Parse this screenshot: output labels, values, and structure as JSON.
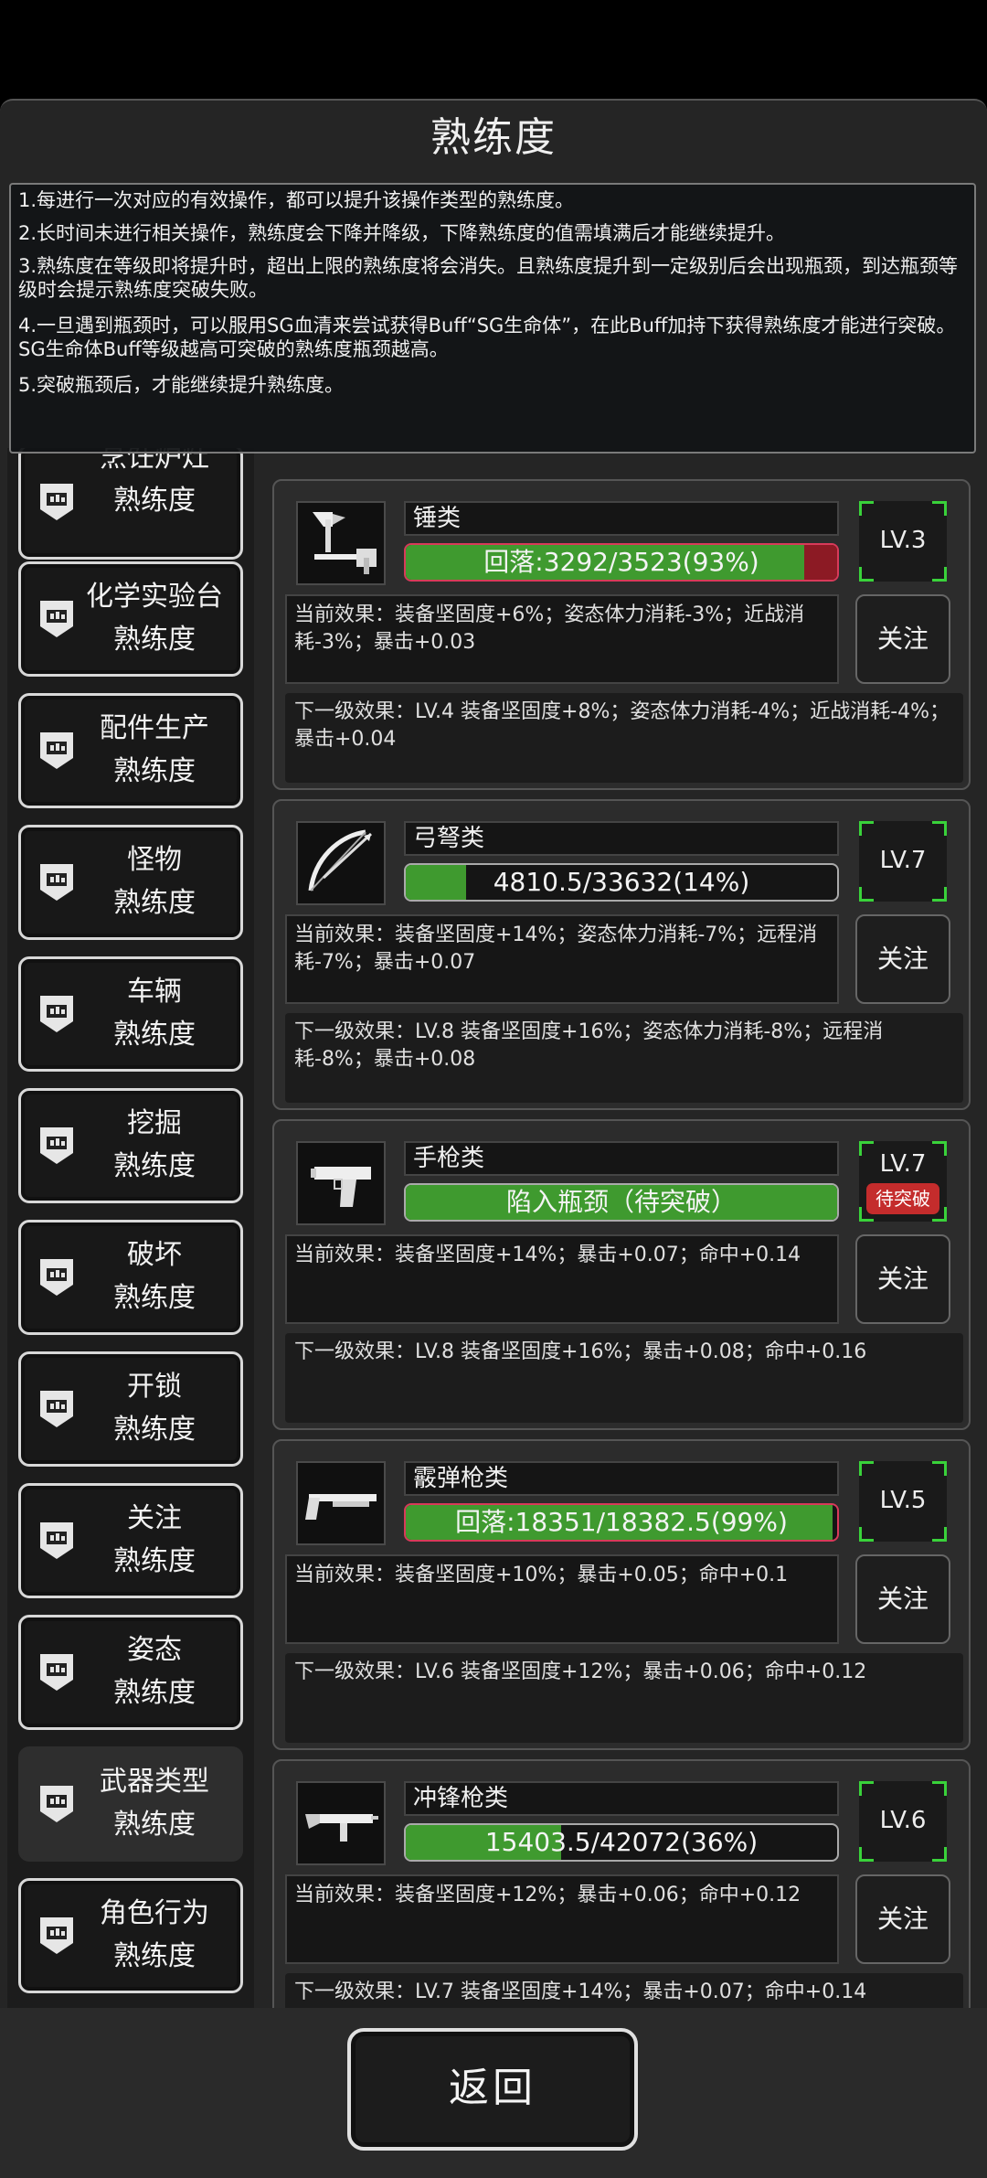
{
  "header": {
    "title": "熟练度"
  },
  "info_lines": [
    "1.每进行一次对应的有效操作，都可以提升该操作类型的熟练度。",
    "2.长时间未进行相关操作，熟练度会下降并降级，下降熟练度的值需填满后才能继续提升。",
    "3.熟练度在等级即将提升时，超出上限的熟练度将会消失。且熟练度提升到一定级别后会出现瓶颈，到达瓶颈等级时会提示熟练度突破失败。",
    "4.一旦遇到瓶颈时，可以服用SG血清来尝试获得Buff“SG生命体”，在此Buff加持下获得熟练度才能进行突破。SG生命体Buff等级越高可突破的熟练度瓶颈越高。",
    "5.突破瓶颈后，才能继续提升熟练度。"
  ],
  "sidebar": {
    "items": [
      {
        "label": "烹饪炉灶",
        "sub": "熟练度"
      },
      {
        "label": "化学实验台",
        "sub": "熟练度"
      },
      {
        "label": "配件生产",
        "sub": "熟练度"
      },
      {
        "label": "怪物",
        "sub": "熟练度"
      },
      {
        "label": "车辆",
        "sub": "熟练度"
      },
      {
        "label": "挖掘",
        "sub": "熟练度"
      },
      {
        "label": "破坏",
        "sub": "熟练度"
      },
      {
        "label": "开锁",
        "sub": "熟练度"
      },
      {
        "label": "关注",
        "sub": "熟练度"
      },
      {
        "label": "姿态",
        "sub": "熟练度"
      },
      {
        "label": "武器类型",
        "sub": "熟练度",
        "active": true
      },
      {
        "label": "角色行为",
        "sub": "熟练度"
      }
    ]
  },
  "cards": [
    {
      "icon": "hammer-axe-icon",
      "name": "锤类",
      "progress_text": "回落:3292/3523(93%)",
      "progress": 0.93,
      "level": "LV.3",
      "current": "当前效果：装备坚固度+6%；姿态体力消耗-3%；近战消耗-3%；暴击+0.03",
      "next": "下一级效果：LV.4 装备坚固度+8%；姿态体力消耗-4%；近战消耗-4%；暴击+0.04",
      "follow": "关注"
    },
    {
      "icon": "bow-icon",
      "name": "弓弩类",
      "progress_text": "4810.5/33632(14%)",
      "progress": 0.14,
      "level": "LV.7",
      "current": "当前效果：装备坚固度+14%；姿态体力消耗-7%；远程消耗-7%；暴击+0.07",
      "next": "下一级效果：LV.8 装备坚固度+16%；姿态体力消耗-8%；远程消耗-8%；暴击+0.08",
      "follow": "关注"
    },
    {
      "icon": "pistol-icon",
      "name": "手枪类",
      "progress_text": "陷入瓶颈（待突破）",
      "progress": 1.0,
      "level": "LV.7",
      "badge": "待突破",
      "current": "当前效果：装备坚固度+14%；暴击+0.07；命中+0.14",
      "next": "下一级效果：LV.8 装备坚固度+16%；暴击+0.08；命中+0.16",
      "follow": "关注"
    },
    {
      "icon": "shotgun-icon",
      "name": "霰弹枪类",
      "progress_text": "回落:18351/18382.5(99%)",
      "progress": 0.99,
      "level": "LV.5",
      "current": "当前效果：装备坚固度+10%；暴击+0.05；命中+0.1",
      "next": "下一级效果：LV.6 装备坚固度+12%；暴击+0.06；命中+0.12",
      "follow": "关注"
    },
    {
      "icon": "smg-icon",
      "name": "冲锋枪类",
      "progress_text": "15403.5/42072(36%)",
      "progress": 0.36,
      "level": "LV.6",
      "current": "当前效果：装备坚固度+12%；暴击+0.06；命中+0.12",
      "next": "下一级效果：LV.7 装备坚固度+14%；暴击+0.07；命中+0.14",
      "follow": "关注"
    }
  ],
  "footer": {
    "back_label": "返回"
  },
  "colors": {
    "progress_green": "#3f9a2f",
    "level_corner": "#39d23a",
    "badge_red": "#c42c2c",
    "fallback_pink": "#d83a5a"
  }
}
